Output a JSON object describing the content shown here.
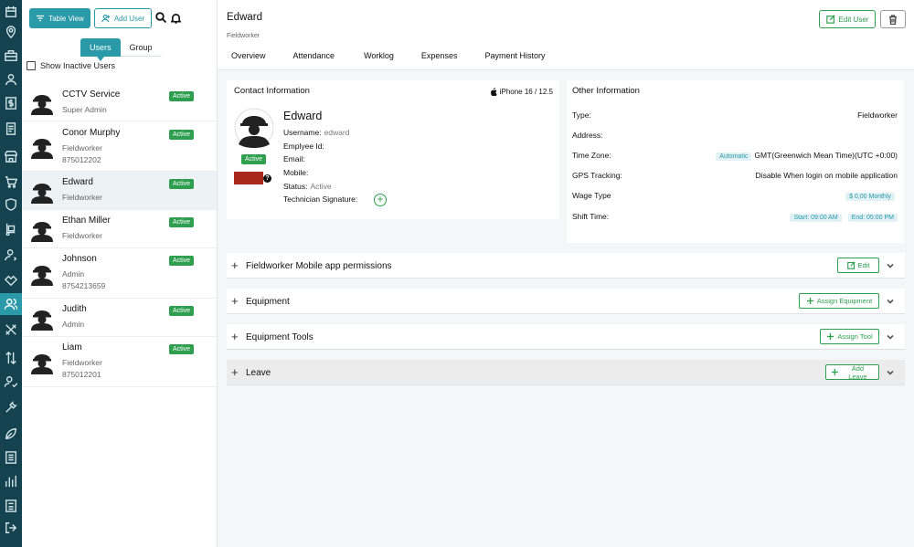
{
  "colors": {
    "rail": "#14424f",
    "accent": "#2a9aa8",
    "success": "#2e9e4f",
    "signature": "#a8281e"
  },
  "rail": {
    "icons": [
      "calendar-icon",
      "map-pin-icon",
      "briefcase-icon",
      "contacts-icon",
      "dollar-icon",
      "invoice-icon",
      "store-icon",
      "cart-icon",
      "shield-icon",
      "truck-icon",
      "user-settings-icon",
      "handshake-icon",
      "users-icon",
      "tools-icon",
      "transfer-icon",
      "user-check-icon",
      "wrench-icon",
      "leaf-icon",
      "report-icon",
      "bar-chart-icon",
      "list-icon",
      "logout-icon"
    ],
    "active": "users-icon"
  },
  "toolbar": {
    "table_view": "Table View",
    "add_user": "Add User"
  },
  "segment": {
    "users": "Users",
    "group": "Group"
  },
  "show_inactive": "Show Inactive Users",
  "users": [
    {
      "name": "CCTV Service",
      "role": "Super Admin",
      "phone": "",
      "status": "Active"
    },
    {
      "name": "Conor Murphy",
      "role": "Fieldworker",
      "phone": "875012202",
      "status": "Active"
    },
    {
      "name": "Edward",
      "role": "Fieldworker",
      "phone": "",
      "status": "Active"
    },
    {
      "name": "Ethan Miller",
      "role": "Fieldworker",
      "phone": "",
      "status": "Active"
    },
    {
      "name": "Johnson",
      "role": "Admin",
      "phone": "8754213659",
      "status": "Active"
    },
    {
      "name": "Judith",
      "role": "Admin",
      "phone": "",
      "status": "Active"
    },
    {
      "name": "Liam",
      "role": "Fieldworker",
      "phone": "875012201",
      "status": "Active"
    }
  ],
  "header": {
    "name": "Edward",
    "role": "Fieldworker",
    "edit_user": "Edit User"
  },
  "tabs": [
    "Overview",
    "Attendance",
    "Worklog",
    "Expenses",
    "Payment History"
  ],
  "contact": {
    "title": "Contact Information",
    "device": "iPhone 16 / 12.5",
    "name": "Edward",
    "status": "Active",
    "username_label": "Username:",
    "username": "edward",
    "employee_id_label": "Emplyee Id:",
    "email_label": "Email:",
    "mobile_label": "Mobile:",
    "status_label": "Status:",
    "status_value": "Active",
    "signature_label": "Technician Signature:"
  },
  "other": {
    "title": "Other Information",
    "type_label": "Type:",
    "type": "Fieldworker",
    "address_label": "Address:",
    "timezone_label": "Time Zone:",
    "timezone_tag": "Automatic",
    "timezone": "GMT(Greenwich Mean Time)(UTC +0:00)",
    "gps_label": "GPS Tracking:",
    "gps": "Disable When login on mobile application",
    "wage_label": "Wage Type",
    "wage": "$ 0,00 Monthly",
    "shift_label": "Shift Time:",
    "shift_start": "Start: 09:00 AM",
    "shift_end": "End: 05:00 PM"
  },
  "sections": {
    "permissions": {
      "title": "Fieldworker Mobile app permissions",
      "button": "Edit"
    },
    "equipment": {
      "title": "Equipment",
      "button": "Assign Equipment"
    },
    "tools": {
      "title": "Equipment Tools",
      "button": "Assign Tool"
    },
    "leave": {
      "title": "Leave",
      "button": "Add Leave"
    }
  }
}
